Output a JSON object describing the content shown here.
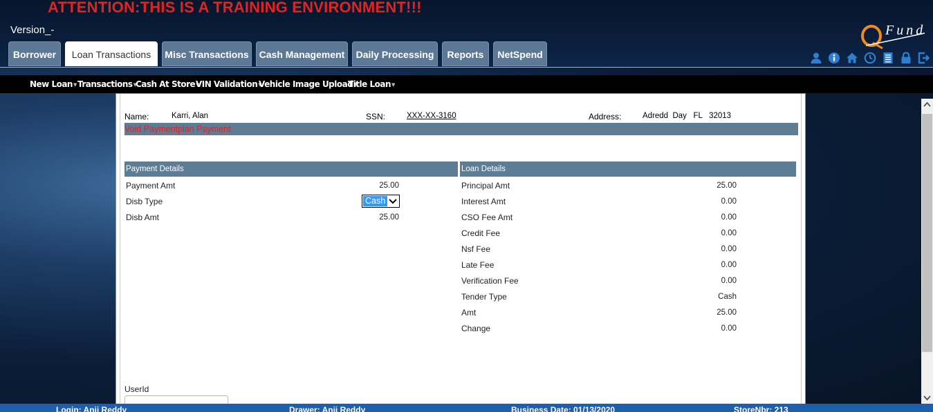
{
  "header": {
    "attention": "ATTENTION:THIS IS A TRAINING ENVIRONMENT!!!",
    "version": "Version_-",
    "logo_text": "Fund",
    "tabs": [
      {
        "label": "Borrower"
      },
      {
        "label": "Loan Transactions",
        "active": true
      },
      {
        "label": "Misc Transactions"
      },
      {
        "label": "Cash Management"
      },
      {
        "label": "Daily Processing"
      },
      {
        "label": "Reports"
      },
      {
        "label": "NetSpend"
      }
    ],
    "icons": [
      "user-icon",
      "info-icon",
      "home-icon",
      "clock-icon",
      "document-icon",
      "lock-icon",
      "logout-icon"
    ],
    "icon_color": "#2e7fd1"
  },
  "submenu": {
    "items": [
      {
        "label": "New Loan"
      },
      {
        "label": "Transactions"
      },
      {
        "label": "Cash At Store"
      },
      {
        "label": "VIN Validation"
      },
      {
        "label": "Vehicle Image Upload"
      },
      {
        "label": "Title Loan"
      }
    ]
  },
  "customer": {
    "name_label": "Name:",
    "name": "Karri, Alan",
    "ssn_label": "SSN:",
    "ssn": "XXX-XX-3160",
    "address_label": "Address:",
    "address": "Adredd  Day   FL   32013"
  },
  "page_title": "Void Paymentplan Payment",
  "payment_details": {
    "heading": "Payment Details",
    "payment_amt_label": "Payment Amt",
    "payment_amt": "25.00",
    "disb_type_label": "Disb Type",
    "disb_type_value": "Cash",
    "disb_amt_label": "Disb Amt",
    "disb_amt": "25.00"
  },
  "loan_details": {
    "heading": "Loan Details",
    "rows": [
      {
        "label": "Principal Amt",
        "value": "25.00"
      },
      {
        "label": "Interest Amt",
        "value": "0.00"
      },
      {
        "label": "CSO Fee Amt",
        "value": "0.00"
      },
      {
        "label": "Credit Fee",
        "value": "0.00"
      },
      {
        "label": "Nsf Fee",
        "value": "0.00"
      },
      {
        "label": "Late Fee",
        "value": "0.00"
      },
      {
        "label": "Verification Fee",
        "value": "0.00"
      },
      {
        "label": "Tender Type",
        "value": "Cash"
      },
      {
        "label": "Amt",
        "value": "25.00"
      },
      {
        "label": "Change",
        "value": "0.00"
      }
    ]
  },
  "userid": {
    "label": "UserId",
    "value": ""
  },
  "footer": {
    "login": "Login: Anji Reddy",
    "drawer": "Drawer: Anji Reddy",
    "business_date": "Business Date: 01/13/2020",
    "store": "StoreNbr: 213"
  },
  "colors": {
    "attention": "#e32222",
    "tab_bg": "#5c7894",
    "section_header": "#5d7d96",
    "title_text": "#e52020",
    "footer_bg": "#1b5fad"
  }
}
